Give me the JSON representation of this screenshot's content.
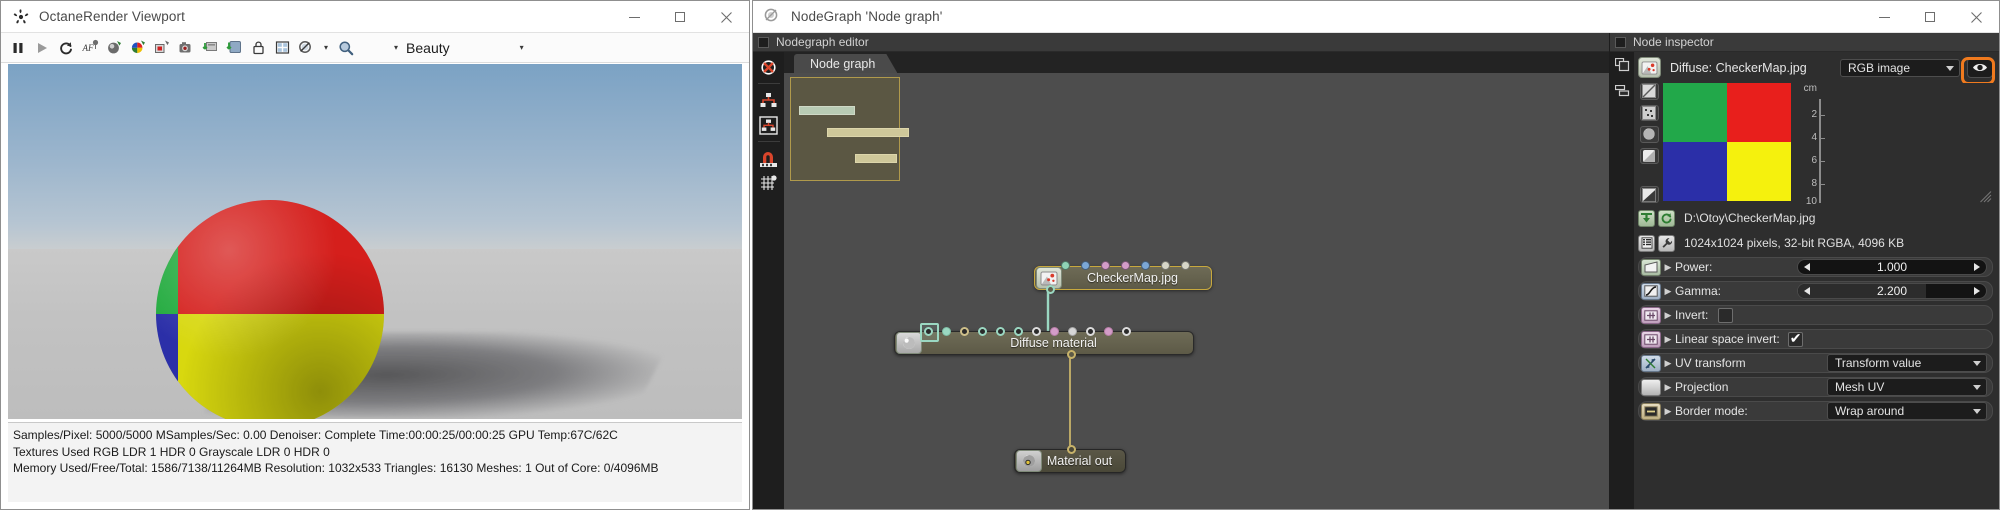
{
  "viewport_window": {
    "title": "OctaneRender Viewport",
    "title_icon": "octane-logo-icon",
    "window_buttons": {
      "minimize": "minimize-icon",
      "maximize": "maximize-icon",
      "close": "close-icon"
    },
    "toolbar": {
      "icons": [
        "pause-icon",
        "play-icon",
        "restart-render-icon",
        "autofocus-icon",
        "render-region-icon",
        "color-picker-icon",
        "pick-material-icon",
        "save-image-icon",
        "save-render-passes-icon",
        "export-icon",
        "lock-resolution-icon",
        "render-layers-icon",
        "denoise-icon",
        "zoom-icon"
      ],
      "pass_dropdown_caret_left": "chevron-down-icon",
      "pass_label": "Beauty",
      "pass_dropdown_caret_right": "chevron-down-icon"
    },
    "status": {
      "line1": "Samples/Pixel: 5000/5000  MSamples/Sec: 0.00  Denoiser: Complete  Time:00:00:25/00:00:25  GPU Temp:67C/62C",
      "line2": "Textures Used RGB LDR 1  HDR 0  Grayscale LDR 0  HDR 0",
      "line3": "Memory Used/Free/Total: 1586/7138/11264MB  Resolution: 1032x533  Triangles: 16130  Meshes: 1 Out of Core: 0/4096MB"
    },
    "render": {
      "object": "sphere",
      "material_colors": {
        "red": "#d51f1c",
        "yellow": "#d8d80f",
        "green": "#22ab3e",
        "blue": "#2b2fa8"
      },
      "sky_color": "#7ba2c4",
      "ground_color": "#c4c4c4"
    }
  },
  "nodegraph_window": {
    "title": "NodeGraph 'Node graph'",
    "title_icon": "nodegraph-icon",
    "window_buttons": {
      "minimize": "minimize-icon",
      "maximize": "maximize-icon",
      "close": "close-icon"
    },
    "editor_header": "Nodegraph editor",
    "tab_label": "Node graph",
    "tools": [
      "unlink-node-icon",
      "expand-graph-icon",
      "collapse-graph-icon",
      "magnet-snap-icon",
      "grid-align-icon"
    ],
    "nodes": [
      {
        "name": "CheckerMap.jpg",
        "icon": "image-texture-icon",
        "selected": true,
        "input_pins": [
          {
            "color": "#8fd3b6"
          },
          {
            "color": "#7ba7d6"
          },
          {
            "color": "#d49cc8"
          },
          {
            "color": "#d49cc8"
          },
          {
            "color": "#7ba7d6"
          },
          {
            "color": "#d6d6c8"
          },
          {
            "color": "#d6d6c8"
          }
        ],
        "output_pin": {
          "color": "#9bd8c2"
        }
      },
      {
        "name": "Diffuse material",
        "icon": "diffuse-material-icon",
        "selected": false,
        "input_pins": [
          {
            "color": "#2a2a2a",
            "ring": "#9bd8c2"
          },
          {
            "color": "#9bd8c2",
            "ring": "#9bd8c2"
          },
          {
            "color": "#2a2a2a",
            "ring": "#cfc08a"
          },
          {
            "color": "#2a2a2a",
            "ring": "#9bd8c2"
          },
          {
            "color": "#2a2a2a",
            "ring": "#9bd8c2"
          },
          {
            "color": "#2a2a2a",
            "ring": "#9bd8c2"
          },
          {
            "color": "#2a2a2a",
            "ring": "#dddddd"
          },
          {
            "color": "#d49cc8",
            "ring": "#d49cc8"
          },
          {
            "color": "#d6d6d6",
            "ring": "#d6d6d6"
          },
          {
            "color": "#2a2a2a",
            "ring": "#dddddd"
          },
          {
            "color": "#d49cc8",
            "ring": "#d49cc8"
          },
          {
            "color": "#2a2a2a",
            "ring": "#dddddd"
          }
        ],
        "output_pin": {
          "color": "#c8b36a"
        }
      },
      {
        "name": "Material out",
        "icon": "material-out-icon",
        "selected": false,
        "input_pin": {
          "color": "#c8b36a"
        }
      }
    ],
    "minimap": {
      "name": "graph-minimap"
    }
  },
  "node_inspector": {
    "header": "Node inspector",
    "rail_icons": [
      "copy-panel-icon",
      "split-panel-icon"
    ],
    "node_icon": "image-texture-icon",
    "node_title": "Diffuse: CheckerMap.jpg",
    "type_dropdown": {
      "value": "RGB image",
      "caret": "chevron-down-icon"
    },
    "visibility_button": {
      "icon": "eye-icon",
      "highlighted": true,
      "highlight_color": "#f07a1e"
    },
    "preview_tools": [
      "checkerboard-alpha-icon",
      "noise-pattern-icon",
      "sphere-preview-icon",
      "plane-preview-icon",
      "gradient-preview-icon"
    ],
    "preview_swatch": {
      "top_left": "#22a84a",
      "top_right": "#e81f1c",
      "bottom_left": "#2b2fa8",
      "bottom_right": "#f5f10d"
    },
    "ruler": {
      "unit": "cm",
      "ticks": [
        "2",
        "4",
        "6",
        "8",
        "10"
      ]
    },
    "file_path": "D:\\Otoy\\CheckerMap.jpg",
    "file_path_icons": [
      "load-image-icon",
      "reload-image-icon"
    ],
    "file_info": "1024x1024 pixels, 32-bit RGBA, 4096 KB",
    "file_info_icons": [
      "image-info-icon",
      "image-settings-icon"
    ],
    "properties": [
      {
        "icon": "power-icon",
        "label": "Power:",
        "control": "slider",
        "value": "1.000",
        "fill_pct": 0
      },
      {
        "icon": "gamma-curve-icon",
        "label": "Gamma:",
        "control": "slider",
        "value": "2.200",
        "fill_pct": 68
      },
      {
        "icon": "invert-icon",
        "label": "Invert:",
        "control": "checkbox",
        "checked": false
      },
      {
        "icon": "invert-icon",
        "label": "Linear space invert:",
        "control": "checkbox",
        "checked": true
      },
      {
        "icon": "uv-transform-icon",
        "label": "UV transform",
        "control": "dropdown",
        "value": "Transform value"
      },
      {
        "icon": "projection-icon",
        "label": "Projection",
        "control": "dropdown",
        "value": "Mesh UV"
      },
      {
        "icon": "border-mode-icon",
        "label": "Border mode:",
        "control": "dropdown",
        "value": "Wrap around"
      }
    ]
  }
}
